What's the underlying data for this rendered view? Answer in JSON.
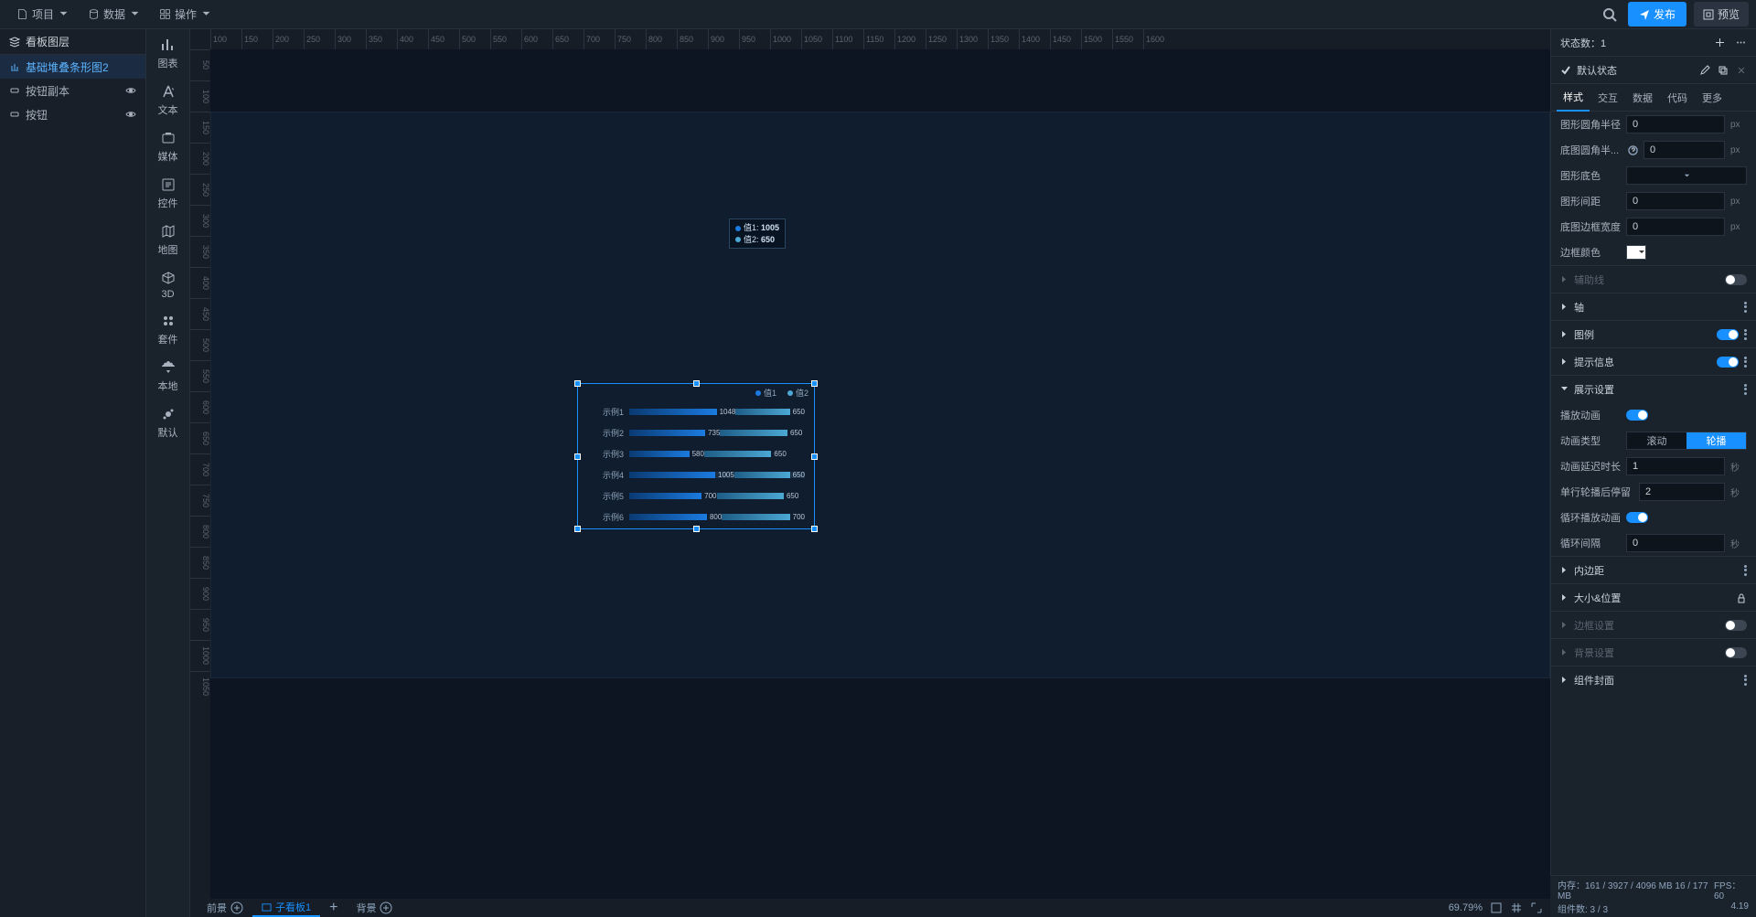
{
  "menu": {
    "project": "项目",
    "data": "数据",
    "operation": "操作"
  },
  "topbar": {
    "publish": "发布",
    "preview": "预览"
  },
  "layers": {
    "title": "看板图层",
    "items": [
      {
        "type": "chart",
        "label": "基础堆叠条形图2",
        "active": true,
        "vis": false
      },
      {
        "type": "btn",
        "label": "按钮副本",
        "active": false,
        "vis": true
      },
      {
        "type": "btn",
        "label": "按钮",
        "active": false,
        "vis": true
      }
    ]
  },
  "tools": [
    {
      "name": "chart",
      "label": "图表"
    },
    {
      "name": "text",
      "label": "文本"
    },
    {
      "name": "media",
      "label": "媒体"
    },
    {
      "name": "control",
      "label": "控件"
    },
    {
      "name": "map",
      "label": "地图"
    },
    {
      "name": "3d",
      "label": "3D"
    },
    {
      "name": "suite",
      "label": "套件"
    },
    {
      "name": "local",
      "label": "本地"
    },
    {
      "name": "default",
      "label": "默认"
    }
  ],
  "ruler_h": [
    "100",
    "150",
    "200",
    "250",
    "300",
    "350",
    "400",
    "450",
    "500",
    "550",
    "600",
    "650",
    "700",
    "750",
    "800",
    "850",
    "900",
    "950",
    "1000",
    "1050",
    "1100",
    "1150",
    "1200",
    "1250",
    "1300",
    "1350",
    "1400",
    "1450",
    "1500",
    "1550",
    "1600"
  ],
  "ruler_v": [
    "50",
    "100",
    "150",
    "200",
    "250",
    "300",
    "350",
    "400",
    "450",
    "500",
    "550",
    "600",
    "650",
    "700",
    "750",
    "800",
    "850",
    "900",
    "950",
    "1000",
    "1050"
  ],
  "chart_data": {
    "type": "bar",
    "orientation": "horizontal",
    "stacked": true,
    "legend": [
      "值1",
      "值2"
    ],
    "categories": [
      "示例1",
      "示例2",
      "示例3",
      "示例4",
      "示例5",
      "示例6"
    ],
    "series": [
      {
        "name": "值1",
        "values": [
          1048,
          735,
          580,
          1005,
          700,
          800
        ],
        "color": "#1b7be0"
      },
      {
        "name": "值2",
        "values": [
          650,
          650,
          650,
          650,
          650,
          700
        ],
        "color": "#4ba8d4"
      }
    ],
    "highlight_index": 3,
    "tooltip": {
      "v1_label": "值1:",
      "v1": "1005",
      "v2_label": "值2:",
      "v2": "650"
    }
  },
  "canvas_tabs": {
    "fg": "前景",
    "child": "子看板1",
    "bg": "背景",
    "zoom": "69.79%"
  },
  "right": {
    "state_count_label": "状态数：",
    "state_count": "1",
    "default_state": "默认状态",
    "tabs": [
      "样式",
      "交互",
      "数据",
      "代码",
      "更多"
    ],
    "active_tab": 0,
    "props": {
      "cornerRadius": {
        "label": "图形圆角半径",
        "value": "0",
        "unit": "px"
      },
      "bgCornerRadius": {
        "label": "底图圆角半...",
        "value": "0",
        "unit": "px",
        "help": true
      },
      "bgColor": {
        "label": "图形底色"
      },
      "gap": {
        "label": "图形间距",
        "value": "0",
        "unit": "px"
      },
      "bgBorderWidth": {
        "label": "底图边框宽度",
        "value": "0",
        "unit": "px"
      },
      "borderColor": {
        "label": "边框颜色",
        "color": "#ffffff"
      }
    },
    "sections": {
      "guide": {
        "label": "辅助线",
        "toggle": false,
        "muted": true
      },
      "axis": {
        "label": "轴"
      },
      "legend": {
        "label": "图例",
        "toggle": true
      },
      "tooltip": {
        "label": "提示信息",
        "toggle": true
      },
      "display": {
        "label": "展示设置",
        "expanded": true,
        "sub": {
          "playAnim": {
            "label": "播放动画",
            "toggle": true
          },
          "animType": {
            "label": "动画类型",
            "options": [
              "滚动",
              "轮播"
            ],
            "active": 1
          },
          "animDelay": {
            "label": "动画延迟时长",
            "value": "1",
            "unit": "秒"
          },
          "rowStay": {
            "label": "单行轮播后停留",
            "value": "2",
            "unit": "秒"
          },
          "loopAnim": {
            "label": "循环播放动画",
            "toggle": true
          },
          "loopGap": {
            "label": "循环间隔",
            "value": "0",
            "unit": "秒"
          }
        }
      },
      "padding": {
        "label": "内边距"
      },
      "sizePos": {
        "label": "大小&位置",
        "locked": true
      },
      "border": {
        "label": "边框设置",
        "toggle": false,
        "muted": true
      },
      "bg": {
        "label": "背景设置",
        "toggle": false,
        "muted": true
      },
      "wrap": {
        "label": "组件封面"
      }
    }
  },
  "status": {
    "mem": "内存：161 / 3927 / 4096 MB  16 / 177 MB",
    "fps": "FPS：60",
    "comp": "组件数: 3 / 3",
    "ver": "4.19"
  }
}
